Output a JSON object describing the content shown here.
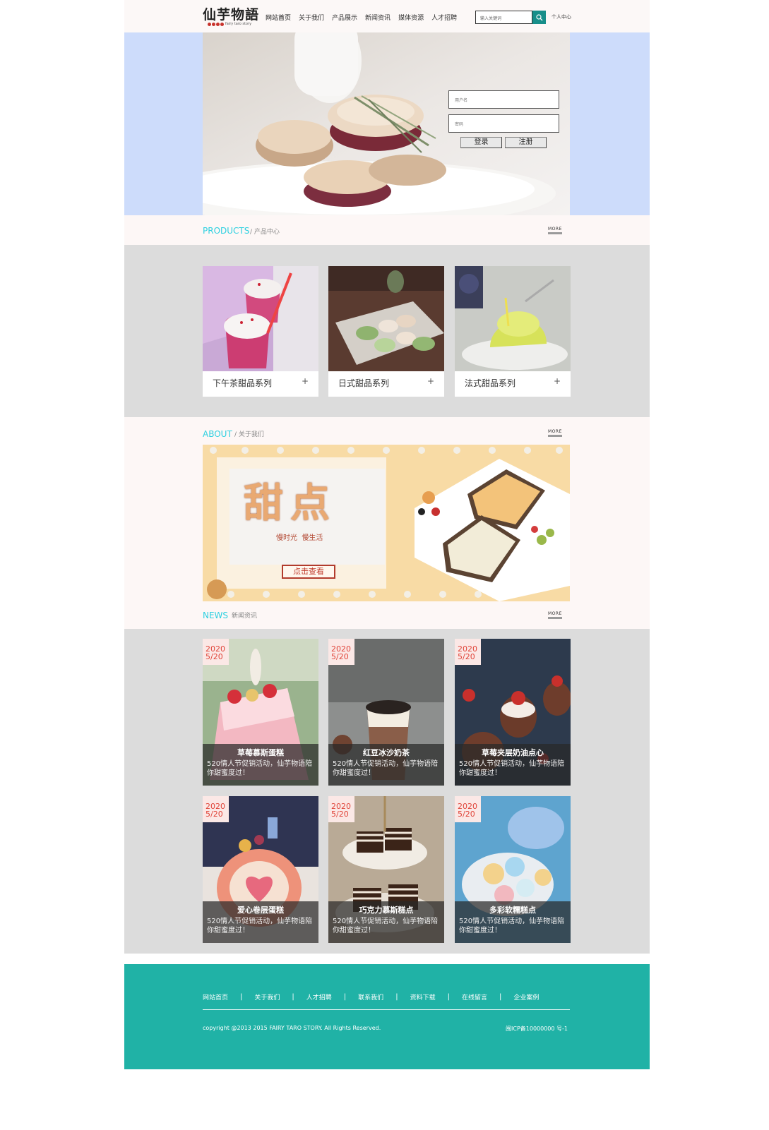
{
  "header": {
    "logo_text": "仙芋物語",
    "logo_sub": "fairy taro story",
    "nav": [
      "网站首页",
      "关于我们",
      "产品展示",
      "新闻资讯",
      "媒体资源",
      "人才招聘"
    ],
    "search_placeholder": "输入关键词",
    "user_center": "个人中心"
  },
  "login": {
    "username_placeholder": "用户名",
    "password_placeholder": "密码",
    "login_label": "登录",
    "register_label": "注册"
  },
  "products": {
    "title": "PRODUCTS",
    "subtitle": "/ 产品中心",
    "more": "MORE",
    "items": [
      {
        "label": "下午茶甜品系列",
        "plus": "+"
      },
      {
        "label": "日式甜品系列",
        "plus": "+"
      },
      {
        "label": "法式甜品系列",
        "plus": "+"
      }
    ]
  },
  "about": {
    "title": "ABOUT",
    "subtitle": "/ 关于我们",
    "more": "MORE",
    "banner_title": "甜点",
    "banner_tagline": "慢时光  慢生活",
    "view_button": "点击查看"
  },
  "news": {
    "title": "NEWS",
    "subtitle": "新闻资讯",
    "more": "MORE",
    "items": [
      {
        "year": "2020",
        "day": "5/20",
        "title": "草莓慕斯蛋糕",
        "desc": "520情人节促销活动，仙芋物语陪你甜蜜度过！"
      },
      {
        "year": "2020",
        "day": "5/20",
        "title": "红豆冰沙奶茶",
        "desc": "520情人节促销活动，仙芋物语陪你甜蜜度过！"
      },
      {
        "year": "2020",
        "day": "5/20",
        "title": "草莓夹层奶油点心",
        "desc": "520情人节促销活动，仙芋物语陪你甜蜜度过！"
      },
      {
        "year": "2020",
        "day": "5/20",
        "title": "爱心卷层蛋糕",
        "desc": "520情人节促销活动，仙芋物语陪你甜蜜度过！"
      },
      {
        "year": "2020",
        "day": "5/20",
        "title": "巧克力慕斯糕点",
        "desc": "520情人节促销活动，仙芋物语陪你甜蜜度过！"
      },
      {
        "year": "2020",
        "day": "5/20",
        "title": "多彩软糯糕点",
        "desc": "520情人节促销活动，仙芋物语陪你甜蜜度过！"
      }
    ]
  },
  "footer": {
    "links": [
      "网站首页",
      "关于我们",
      "人才招聘",
      "联系我们",
      "资料下载",
      "在线留言",
      "企业案例"
    ],
    "copyright": "copyright @2013 2015 FAIRY TARO STORY. All Rights Reserved.",
    "icp": "闽ICP备10000000 号-1"
  },
  "colors": {
    "accent_cyan": "#2dd0e0",
    "footer_teal": "#20b2a6",
    "search_button": "#178f8a",
    "banner_blue": "#cddcfb",
    "date_red": "#e0453a"
  }
}
